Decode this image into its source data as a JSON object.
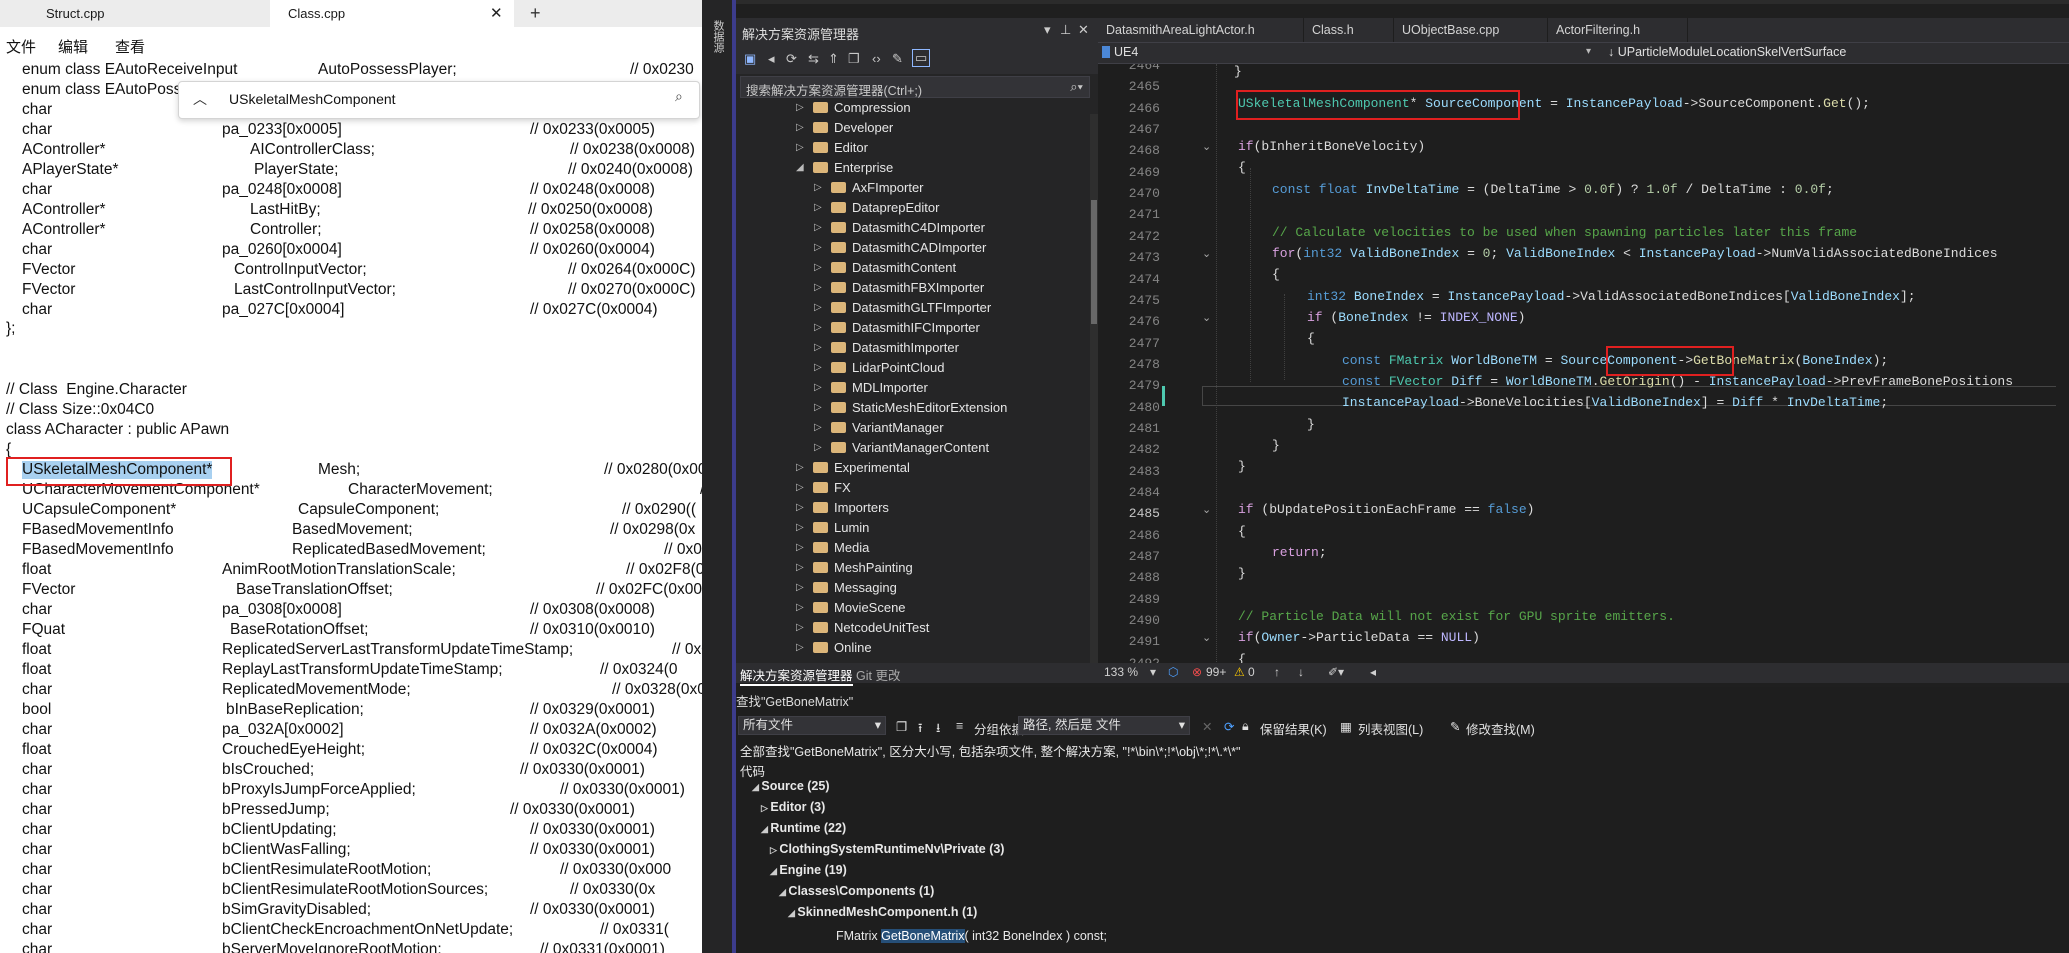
{
  "notepad": {
    "tabs": [
      {
        "label": "Struct.cpp",
        "active": false
      },
      {
        "label": "Class.cpp",
        "active": true
      }
    ],
    "close_glyph": "✕",
    "new_tab_glyph": "+",
    "menu": [
      "文件",
      "编辑",
      "查看"
    ],
    "find": {
      "value": "USkeletalMeshComponent",
      "chevron": "︿",
      "search_icon": "⌕"
    },
    "lines": [
      {
        "type": "enum class EAutoReceiveInput",
        "name": "AutoPossessPlayer;",
        "comment": "// 0x0230"
      },
      {
        "type": "enum class EAutoPossessAI",
        "name": "",
        "comment": ""
      },
      {
        "type": "char",
        "name": "",
        "comment": ""
      },
      {
        "type": "char",
        "name": "pa_0233[0x0005]",
        "comment": "// 0x0233(0x0005)"
      },
      {
        "type": "AController*",
        "name": "AIControllerClass;",
        "comment": "// 0x0238(0x0008)"
      },
      {
        "type": "APlayerState*",
        "name": "PlayerState;",
        "comment": "// 0x0240(0x0008)"
      },
      {
        "type": "char",
        "name": "pa_0248[0x0008]",
        "comment": "// 0x0248(0x0008)"
      },
      {
        "type": "AController*",
        "name": "LastHitBy;",
        "comment": "// 0x0250(0x0008)"
      },
      {
        "type": "AController*",
        "name": "Controller;",
        "comment": "// 0x0258(0x0008)"
      },
      {
        "type": "char",
        "name": "pa_0260[0x0004]",
        "comment": "// 0x0260(0x0004)"
      },
      {
        "type": "FVector",
        "name": "ControlInputVector;",
        "comment": "// 0x0264(0x000C)"
      },
      {
        "type": "FVector",
        "name": "LastControlInputVector;",
        "comment": "// 0x0270(0x000C)"
      },
      {
        "type": "char",
        "name": "pa_027C[0x0004]",
        "comment": "// 0x027C(0x0004)"
      }
    ],
    "close_brace": "};",
    "class_comment": "// Class  Engine.Character",
    "size_comment": "// Class Size::0x04C0",
    "class_decl": "class ACharacter : public APawn",
    "open_brace": "{",
    "members": [
      {
        "type": "USkeletalMeshComponent*",
        "name": "Mesh;",
        "comment": "// 0x0280(0x000"
      },
      {
        "type": "UCharacterMovementComponent*",
        "name": "CharacterMovement;",
        "comment": "// 0"
      },
      {
        "type": "UCapsuleComponent*",
        "name": "CapsuleComponent;",
        "comment": "// 0x0290(("
      },
      {
        "type": "FBasedMovementInfo",
        "name": "BasedMovement;",
        "comment": "// 0x0298(0x"
      },
      {
        "type": "FBasedMovementInfo",
        "name": "ReplicatedBasedMovement;",
        "comment": "// 0x02"
      },
      {
        "type": "float",
        "name": "AnimRootMotionTranslationScale;",
        "comment": "// 0x02F8(0x00"
      },
      {
        "type": "FVector",
        "name": "BaseTranslationOffset;",
        "comment": "// 0x02FC(0x000C)"
      },
      {
        "type": "char",
        "name": "pa_0308[0x0008]",
        "comment": "// 0x0308(0x0008)"
      },
      {
        "type": "FQuat",
        "name": "BaseRotationOffset;",
        "comment": "// 0x0310(0x0010)"
      },
      {
        "type": "float",
        "name": "ReplicatedServerLastTransformUpdateTimeStamp;",
        "comment": "// 0x03"
      },
      {
        "type": "float",
        "name": "ReplayLastTransformUpdateTimeStamp;",
        "comment": "// 0x0324(0"
      },
      {
        "type": "char",
        "name": "ReplicatedMovementMode;",
        "comment": "// 0x0328(0x000"
      },
      {
        "type": "bool",
        "name": "bInBaseReplication;",
        "comment": "// 0x0329(0x0001)"
      },
      {
        "type": "char",
        "name": "pa_032A[0x0002]",
        "comment": "// 0x032A(0x0002)"
      },
      {
        "type": "float",
        "name": "CrouchedEyeHeight;",
        "comment": "// 0x032C(0x0004)"
      },
      {
        "type": "char",
        "name": "bIsCrouched;",
        "comment": "// 0x0330(0x0001)"
      },
      {
        "type": "char",
        "name": "bProxyIsJumpForceApplied;",
        "comment": "// 0x0330(0x0001)"
      },
      {
        "type": "char",
        "name": "bPressedJump;",
        "comment": "// 0x0330(0x0001)"
      },
      {
        "type": "char",
        "name": "bClientUpdating;",
        "comment": "// 0x0330(0x0001)"
      },
      {
        "type": "char",
        "name": "bClientWasFalling;",
        "comment": "// 0x0330(0x0001)"
      },
      {
        "type": "char",
        "name": "bClientResimulateRootMotion;",
        "comment": "// 0x0330(0x000"
      },
      {
        "type": "char",
        "name": "bClientResimulateRootMotionSources;",
        "comment": "// 0x0330(0x"
      },
      {
        "type": "char",
        "name": "bSimGravityDisabled;",
        "comment": "// 0x0330(0x0001)"
      },
      {
        "type": "char",
        "name": "bClientCheckEncroachmentOnNetUpdate;",
        "comment": "// 0x0331("
      },
      {
        "type": "char",
        "name": "bServerMoveIgnoreRootMotion;",
        "comment": "// 0x0331(0x0001)"
      }
    ]
  },
  "vs": {
    "side_label": "数据源",
    "solution": {
      "title": "解决方案资源管理器",
      "search_placeholder": "搜索解决方案资源管理器(Ctrl+;)",
      "tabs": [
        "解决方案资源管理器",
        "Git 更改"
      ],
      "tree": [
        {
          "label": "Compression",
          "depth": 0,
          "expanded": false
        },
        {
          "label": "Developer",
          "depth": 0,
          "expanded": false
        },
        {
          "label": "Editor",
          "depth": 0,
          "expanded": false
        },
        {
          "label": "Enterprise",
          "depth": 0,
          "expanded": true
        },
        {
          "label": "AxFImporter",
          "depth": 1,
          "expanded": false
        },
        {
          "label": "DataprepEditor",
          "depth": 1,
          "expanded": false
        },
        {
          "label": "DatasmithC4DImporter",
          "depth": 1,
          "expanded": false
        },
        {
          "label": "DatasmithCADImporter",
          "depth": 1,
          "expanded": false
        },
        {
          "label": "DatasmithContent",
          "depth": 1,
          "expanded": false
        },
        {
          "label": "DatasmithFBXImporter",
          "depth": 1,
          "expanded": false
        },
        {
          "label": "DatasmithGLTFImporter",
          "depth": 1,
          "expanded": false
        },
        {
          "label": "DatasmithIFCImporter",
          "depth": 1,
          "expanded": false
        },
        {
          "label": "DatasmithImporter",
          "depth": 1,
          "expanded": false
        },
        {
          "label": "LidarPointCloud",
          "depth": 1,
          "expanded": false
        },
        {
          "label": "MDLImporter",
          "depth": 1,
          "expanded": false
        },
        {
          "label": "StaticMeshEditorExtension",
          "depth": 1,
          "expanded": false
        },
        {
          "label": "VariantManager",
          "depth": 1,
          "expanded": false
        },
        {
          "label": "VariantManagerContent",
          "depth": 1,
          "expanded": false
        },
        {
          "label": "Experimental",
          "depth": 0,
          "expanded": false
        },
        {
          "label": "FX",
          "depth": 0,
          "expanded": false
        },
        {
          "label": "Importers",
          "depth": 0,
          "expanded": false
        },
        {
          "label": "Lumin",
          "depth": 0,
          "expanded": false
        },
        {
          "label": "Media",
          "depth": 0,
          "expanded": false
        },
        {
          "label": "MeshPainting",
          "depth": 0,
          "expanded": false
        },
        {
          "label": "Messaging",
          "depth": 0,
          "expanded": false
        },
        {
          "label": "MovieScene",
          "depth": 0,
          "expanded": false
        },
        {
          "label": "NetcodeUnitTest",
          "depth": 0,
          "expanded": false
        },
        {
          "label": "Online",
          "depth": 0,
          "expanded": false
        }
      ]
    },
    "editor": {
      "tabs": [
        "DatasmithAreaLightActor.h",
        "Class.h",
        "UObjectBase.cpp",
        "ActorFiltering.h"
      ],
      "nav_left": "UE4",
      "nav_right": "↓ UParticleModuleLocationSkelVertSurface",
      "line_numbers": [
        "2464",
        "2465",
        "2466",
        "2467",
        "2468",
        "2469",
        "2470",
        "2471",
        "2472",
        "2473",
        "2474",
        "2475",
        "2476",
        "2477",
        "2478",
        "2479",
        "2480",
        "2481",
        "2482",
        "2483",
        "2484",
        "2485",
        "2486",
        "2487",
        "2488",
        "2489",
        "2490",
        "2491",
        "2492"
      ],
      "current_line": "2485",
      "status": {
        "zoom": "133 %",
        "errors": "99+",
        "warnings": "0"
      }
    },
    "find_results": {
      "title": "查找\"GetBoneMatrix\"",
      "scope": "所有文件",
      "group_by_label": "分组依据:",
      "group_by_value": "路径, 然后是 文件",
      "keep_results": "保留结果(K)",
      "list_view": "列表视图(L)",
      "modify_find": "修改查找(M)",
      "summary": "全部查找\"GetBoneMatrix\", 区分大小写, 包括杂项文件, 整个解决方案, \"!*\\bin\\*;!*\\obj\\*;!*\\.*\\*\"",
      "code_header": "代码",
      "rows": [
        {
          "label": "Source (25)",
          "depth": 0
        },
        {
          "label": "Editor (3)",
          "depth": 1
        },
        {
          "label": "Runtime (22)",
          "depth": 1
        },
        {
          "label": "ClothingSystemRuntimeNv\\Private (3)",
          "depth": 2
        },
        {
          "label": "Engine (19)",
          "depth": 2
        },
        {
          "label": "Classes\\Components (1)",
          "depth": 3
        },
        {
          "label": "SkinnedMeshComponent.h (1)",
          "depth": 4
        }
      ],
      "result_line": {
        "before": "FMatrix ",
        "match": "GetBoneMatrix",
        "after": "( int32 BoneIndex ) const;"
      }
    }
  }
}
